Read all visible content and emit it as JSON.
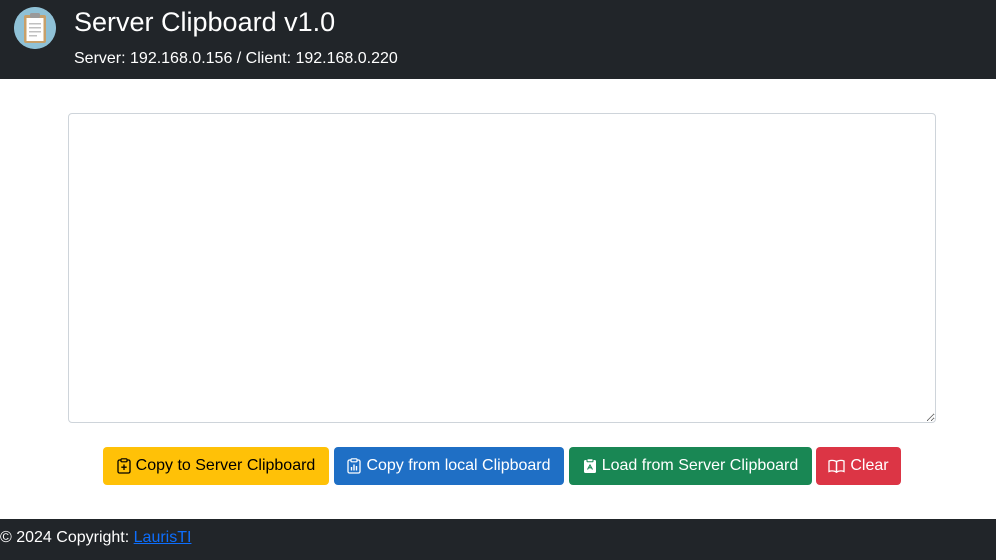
{
  "header": {
    "title": "Server Clipboard v1.0",
    "subtitle": "Server: 192.168.0.156 / Client: 192.168.0.220",
    "logo_icon": "clipboard-icon"
  },
  "editor": {
    "value": "",
    "placeholder": ""
  },
  "buttons": {
    "copy_to_server": {
      "label": "Copy to Server Clipboard",
      "icon": "clipboard-plus-icon",
      "color": "#ffc107"
    },
    "copy_from_local": {
      "label": "Copy from local Clipboard",
      "icon": "clipboard-data-icon",
      "color": "#1f6fc5"
    },
    "load_from_server": {
      "label": "Load from Server Clipboard",
      "icon": "clipboard-check-icon",
      "color": "#198754"
    },
    "clear": {
      "label": "Clear",
      "icon": "book-icon",
      "color": "#dc3545"
    }
  },
  "footer": {
    "copyright": "© 2024 Copyright:",
    "link_text": "LaurisTI"
  }
}
